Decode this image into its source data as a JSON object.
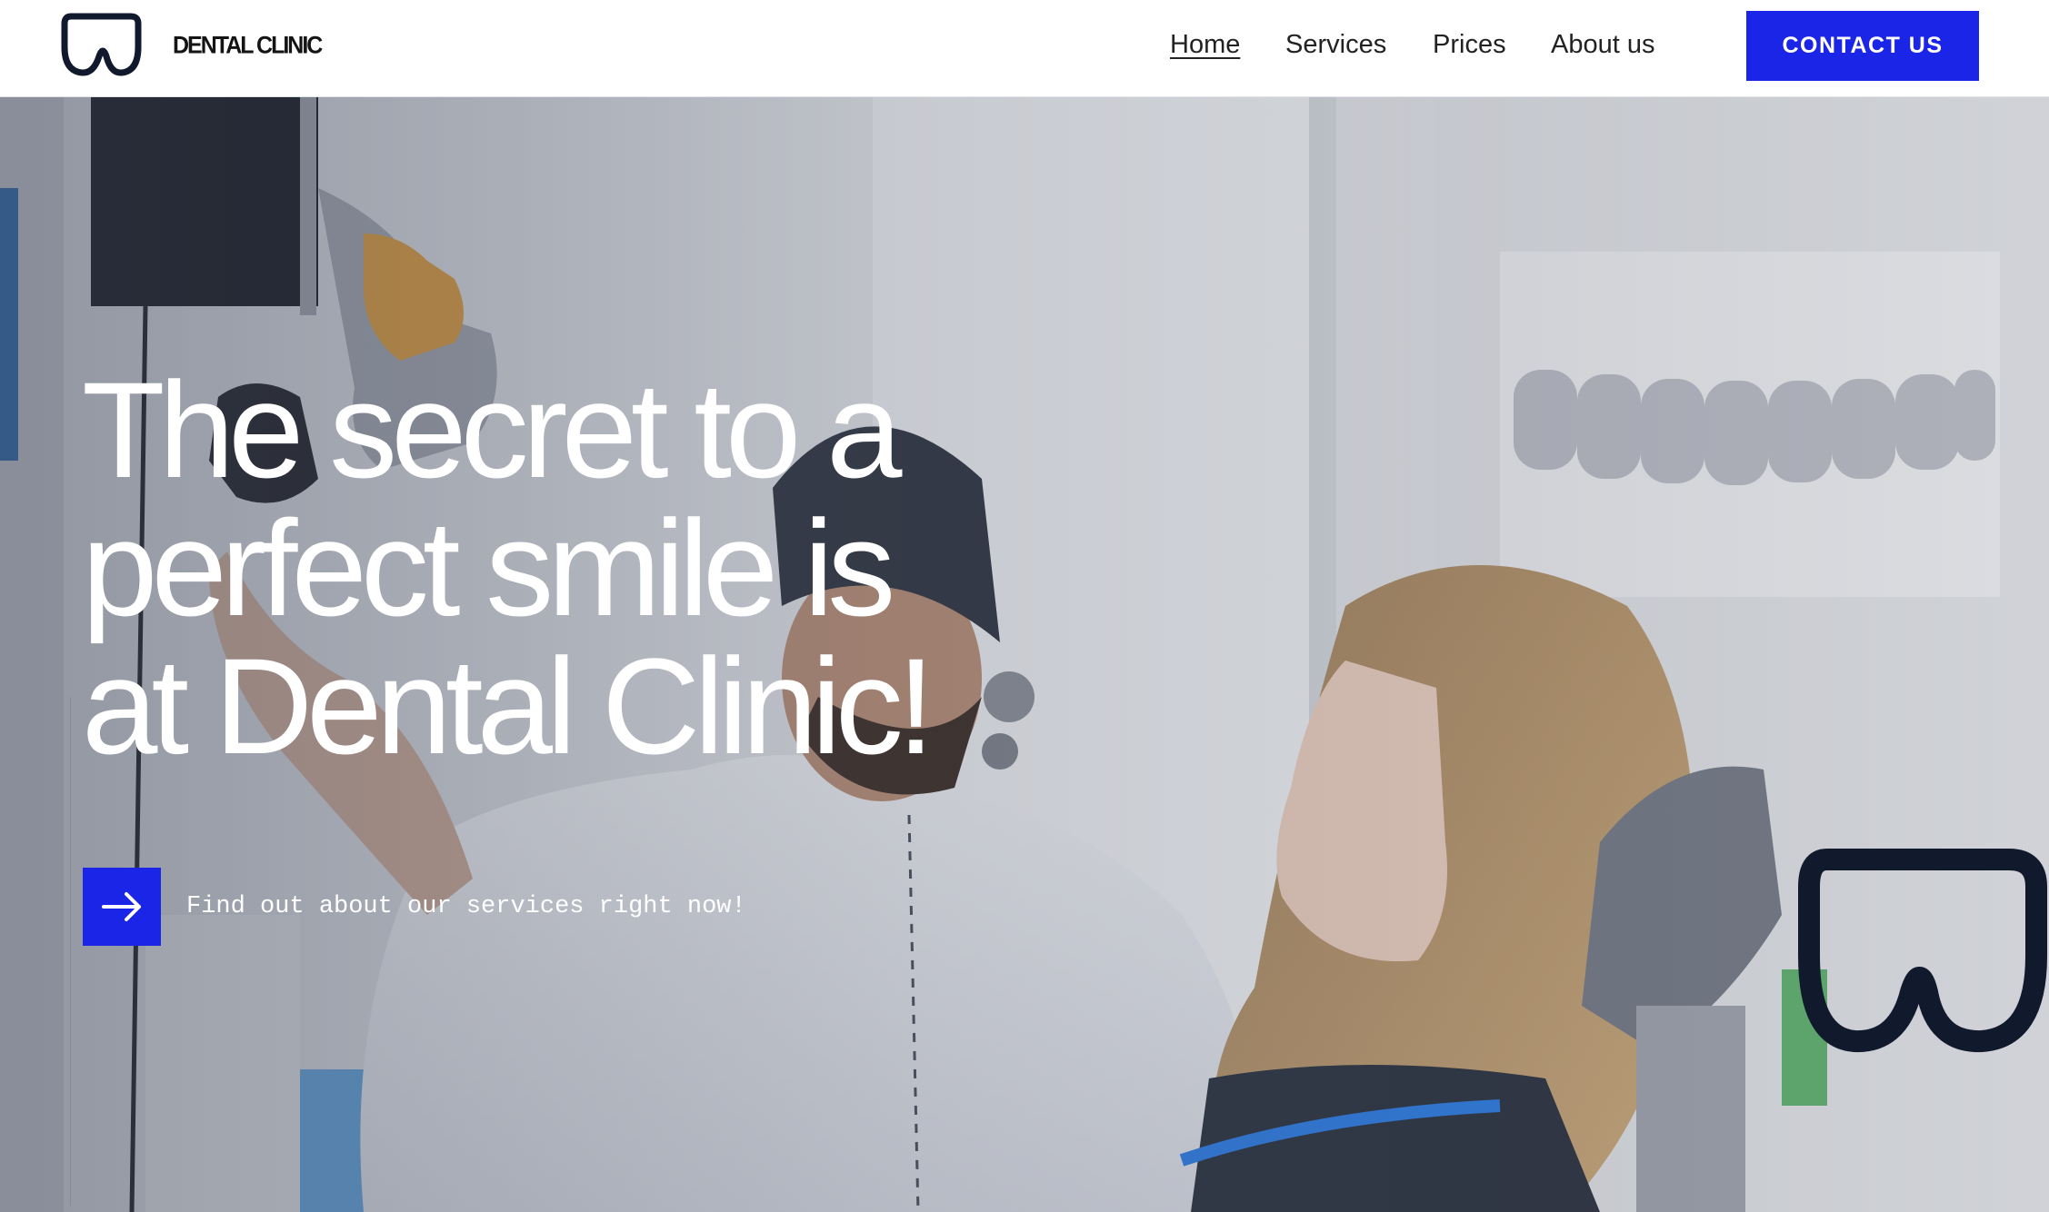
{
  "header": {
    "brand": "DENTAL CLINIC",
    "logo_icon": "tooth-icon",
    "nav": [
      {
        "label": "Home",
        "active": true
      },
      {
        "label": "Services",
        "active": false
      },
      {
        "label": "Prices",
        "active": false
      },
      {
        "label": "About us",
        "active": false
      }
    ],
    "contact_label": "CONTACT  US"
  },
  "hero": {
    "title_lines": [
      "The secret to a",
      "perfect smile is",
      "at Dental Clinic!"
    ],
    "cta_icon": "arrow-right-icon",
    "cta_text": "Find out about our services right now!",
    "decor_icon": "tooth-icon"
  },
  "colors": {
    "accent": "#1b25e8",
    "logo_outline": "#111a2c",
    "text_dark": "#222222",
    "hero_text": "#ffffff"
  }
}
